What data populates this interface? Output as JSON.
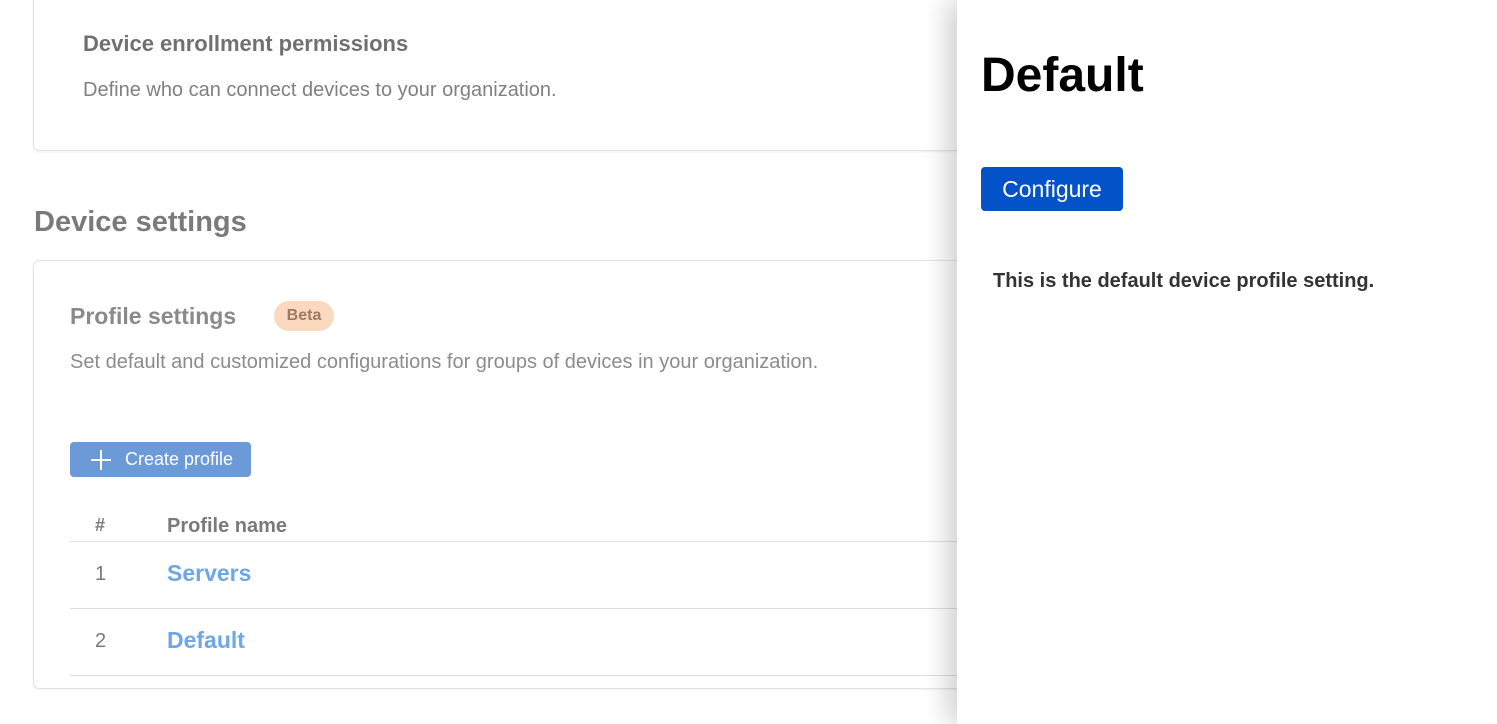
{
  "enrollment": {
    "title": "Device enrollment permissions",
    "description": "Define who can connect devices to your organization."
  },
  "device_settings": {
    "heading": "Device settings"
  },
  "profile_settings": {
    "title": "Profile settings",
    "badge": "Beta",
    "description": "Set default and customized configurations for groups of devices in your organization.",
    "create_button": "Create profile",
    "table": {
      "columns": [
        "#",
        "Profile name"
      ],
      "rows": [
        {
          "num": "1",
          "name": "Servers"
        },
        {
          "num": "2",
          "name": "Default"
        }
      ]
    }
  },
  "panel": {
    "title": "Default",
    "configure_button": "Configure",
    "description": "This is the default device profile setting."
  },
  "colors": {
    "configure_button": "#0352c8",
    "create_button": "#6c9ad8",
    "beta_badge": "#fbd9bf",
    "link": "#6ea6e8"
  }
}
